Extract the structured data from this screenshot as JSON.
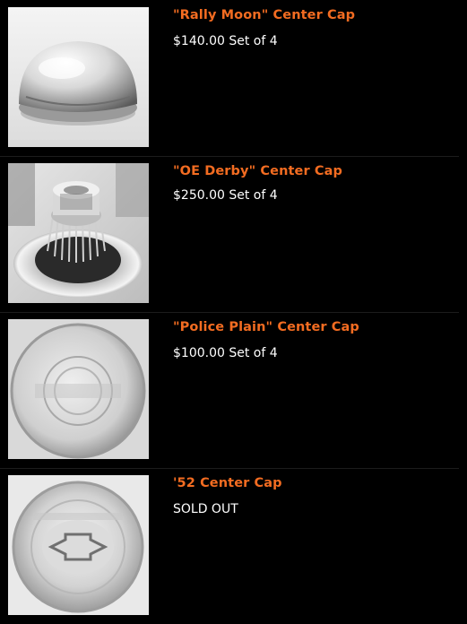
{
  "products": [
    {
      "title": "\"Rally Moon\" Center Cap",
      "price": "$140.00 Set of 4",
      "image": "rally-moon-cap"
    },
    {
      "title": "\"OE Derby\" Center Cap",
      "price": "$250.00 Set of 4",
      "image": "oe-derby-cap"
    },
    {
      "title": "\"Police Plain\" Center Cap",
      "price": "$100.00 Set of 4",
      "image": "police-plain-cap"
    },
    {
      "title": "'52 Center Cap",
      "price": "SOLD OUT",
      "image": "52-center-cap"
    }
  ],
  "colors": {
    "accent": "#f36c21",
    "background": "#000000",
    "text": "#ffffff"
  }
}
